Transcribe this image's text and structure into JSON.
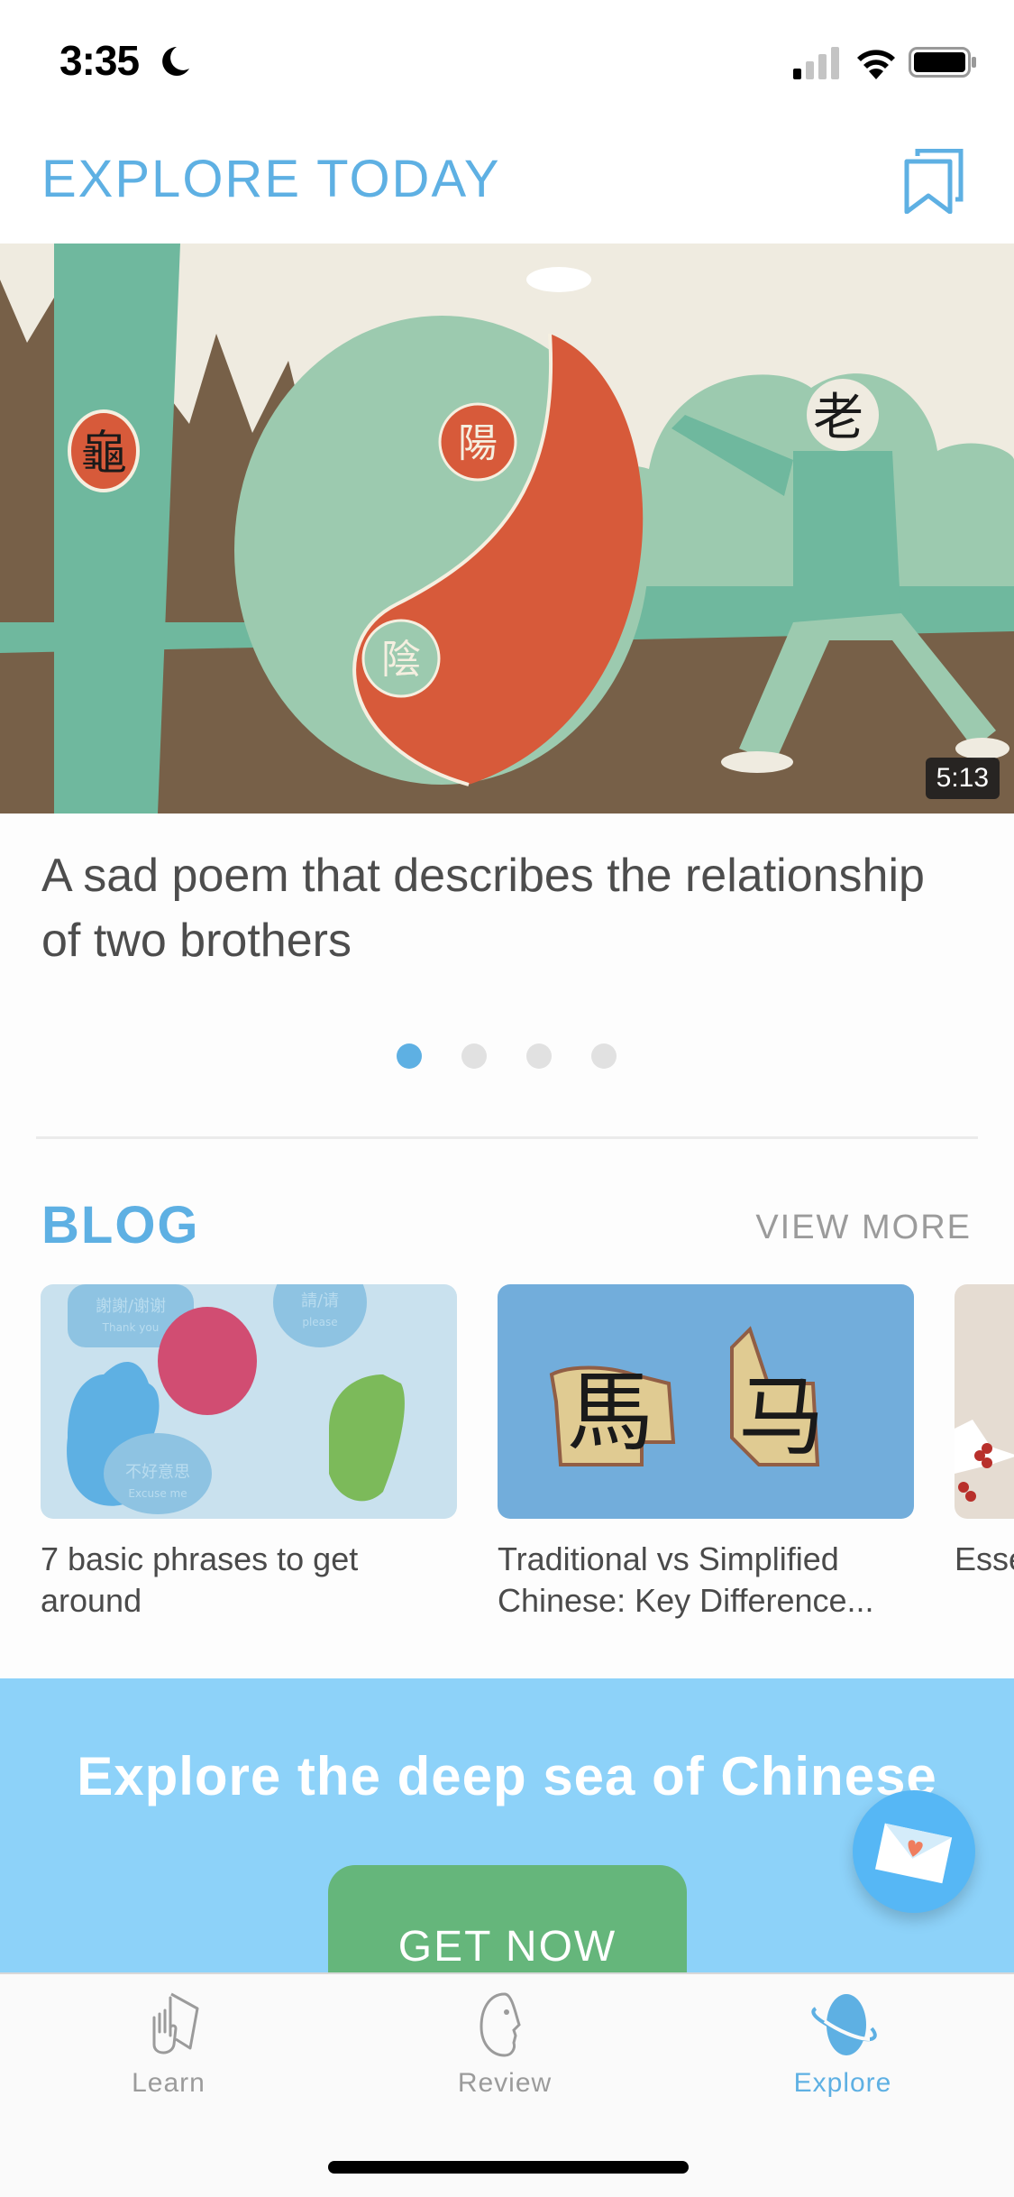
{
  "status_bar": {
    "time": "3:35",
    "focus_icon": "moon-icon",
    "signal_icon": "cellular-signal-icon",
    "wifi_icon": "wifi-icon",
    "battery_icon": "battery-icon"
  },
  "header": {
    "title": "EXPLORE TODAY",
    "bookmark_icon": "bookmarks-icon"
  },
  "hero": {
    "duration": "5:13",
    "caption": "A sad poem that describes the relationship of two brothers",
    "image_characters": [
      "龜",
      "陽",
      "陰",
      "老"
    ],
    "carousel": {
      "count": 4,
      "active_index": 0
    }
  },
  "blog": {
    "title": "BLOG",
    "view_more": "VIEW MORE",
    "posts": [
      {
        "title": "7 basic phrases to get around",
        "image_text": [
          "謝謝/谢谢",
          "Thank you",
          "請/请",
          "please",
          "不好意思",
          "Excuse me"
        ]
      },
      {
        "title": "Traditional vs Simplified Chinese: Key Difference...",
        "image_text": [
          "馬",
          "马"
        ]
      },
      {
        "title": "Esse... Voc..."
      }
    ]
  },
  "promo": {
    "title": "Explore the deep sea of Chinese",
    "button": "GET NOW",
    "fab_icon": "mail-heart-icon"
  },
  "tabbar": {
    "tabs": [
      {
        "label": "Learn",
        "icon": "hand-card-icon",
        "active": false
      },
      {
        "label": "Review",
        "icon": "face-profile-icon",
        "active": false
      },
      {
        "label": "Explore",
        "icon": "planet-icon",
        "active": true
      }
    ]
  },
  "colors": {
    "accent": "#5eb0e3",
    "promo_bg": "#8dd2f9",
    "button_green": "#65b67b",
    "fab_blue": "#56b7f5"
  }
}
